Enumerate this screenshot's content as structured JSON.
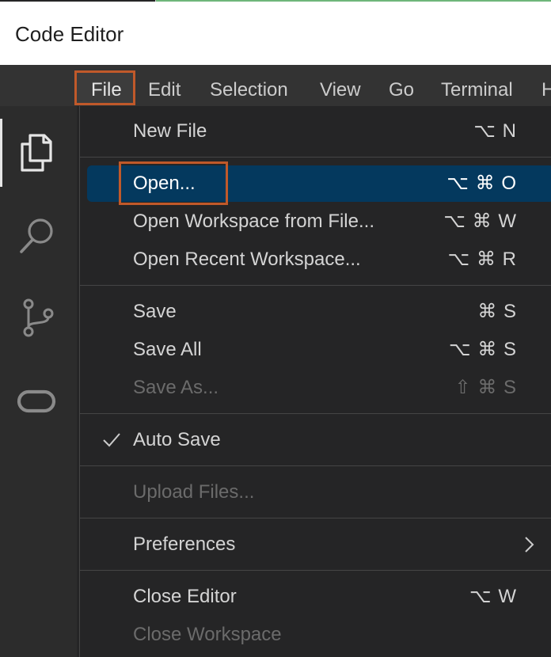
{
  "app": {
    "title": "Code Editor"
  },
  "menubar": {
    "items": [
      {
        "label": "File"
      },
      {
        "label": "Edit"
      },
      {
        "label": "Selection"
      },
      {
        "label": "View"
      },
      {
        "label": "Go"
      },
      {
        "label": "Terminal"
      },
      {
        "label": "H"
      }
    ],
    "active": "File"
  },
  "activitybar": {
    "icons": [
      "files-icon",
      "search-icon",
      "source-control-icon",
      "remote-icon"
    ],
    "active": "files-icon"
  },
  "file_menu": {
    "items": {
      "new_file": {
        "label": "New File",
        "shortcut": "⌥ N"
      },
      "open": {
        "label": "Open...",
        "shortcut": "⌥ ⌘ O"
      },
      "open_workspace": {
        "label": "Open Workspace from File...",
        "shortcut": "⌥ ⌘ W"
      },
      "open_recent": {
        "label": "Open Recent Workspace...",
        "shortcut": "⌥ ⌘ R"
      },
      "save": {
        "label": "Save",
        "shortcut": "⌘ S"
      },
      "save_all": {
        "label": "Save All",
        "shortcut": "⌥ ⌘ S"
      },
      "save_as": {
        "label": "Save As...",
        "shortcut": "⇧ ⌘ S"
      },
      "auto_save": {
        "label": "Auto Save",
        "checked": true
      },
      "upload_files": {
        "label": "Upload Files..."
      },
      "preferences": {
        "label": "Preferences"
      },
      "close_editor": {
        "label": "Close Editor",
        "shortcut": "⌥ W"
      },
      "close_workspace": {
        "label": "Close Workspace"
      }
    },
    "selected": "open"
  },
  "colors": {
    "highlight_border": "#c0592a",
    "selection_bg": "#04395e",
    "menu_bg": "#252526",
    "menubar_bg": "#333333"
  }
}
